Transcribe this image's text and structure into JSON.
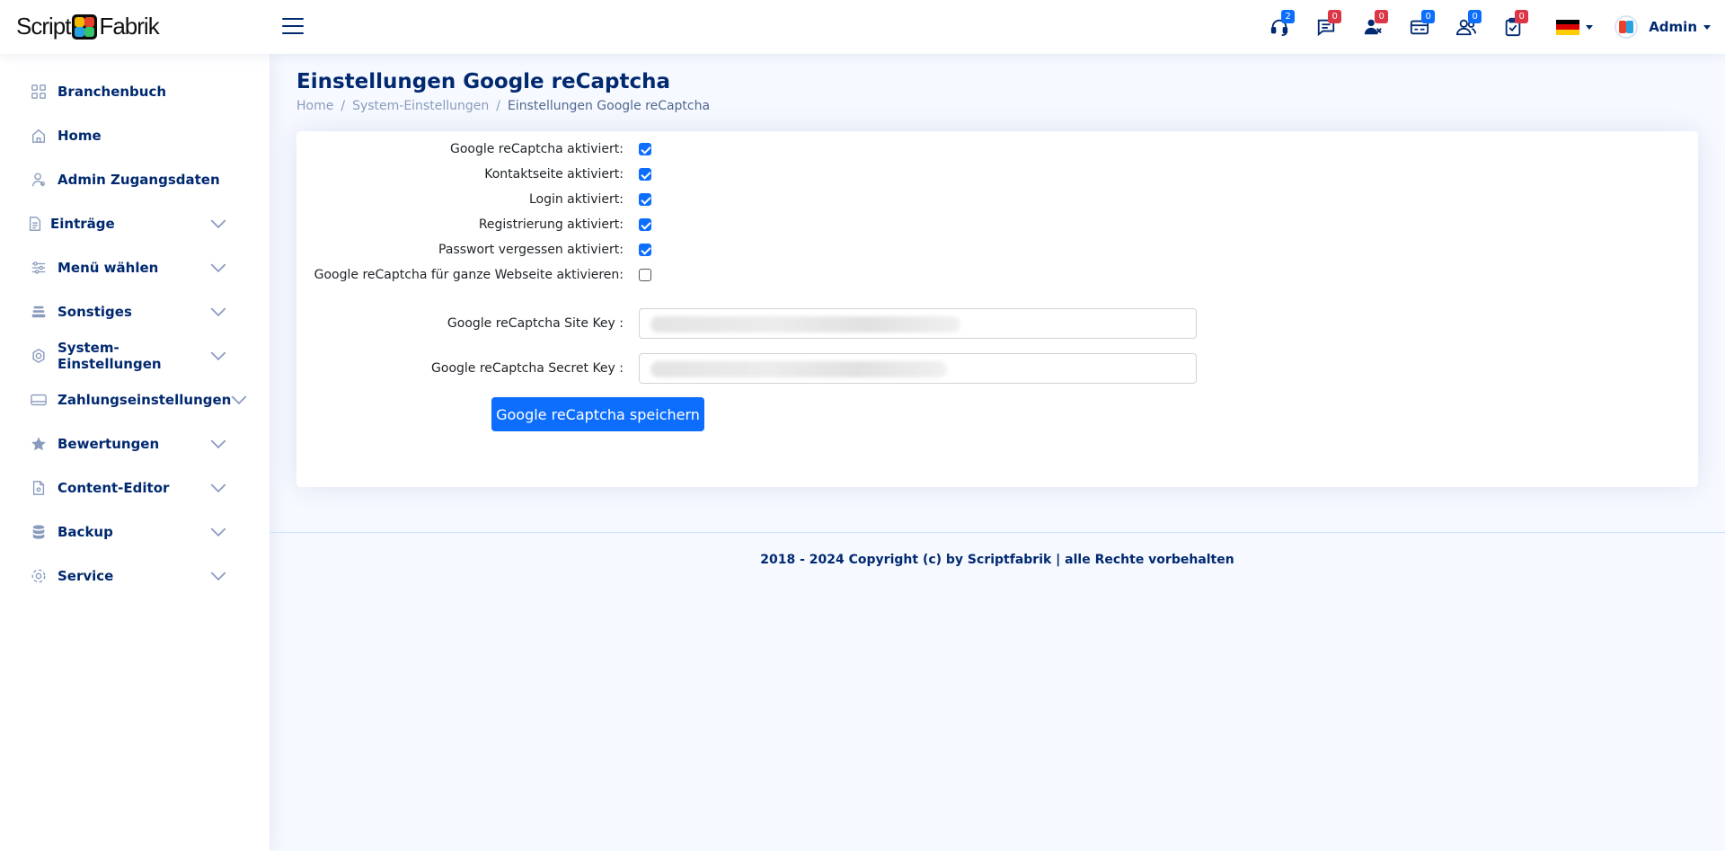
{
  "header": {
    "logo_left": "Script",
    "logo_right": "Fabrik",
    "notifications": [
      {
        "icon": "headset-icon",
        "count": "2",
        "color": "blue"
      },
      {
        "icon": "chat-icon",
        "count": "0",
        "color": "red"
      },
      {
        "icon": "user-x-icon",
        "count": "0",
        "color": "red"
      },
      {
        "icon": "card-icon",
        "count": "0",
        "color": "blue"
      },
      {
        "icon": "people-icon",
        "count": "0",
        "color": "blue"
      },
      {
        "icon": "clipboard-check-icon",
        "count": "0",
        "color": "red"
      }
    ],
    "profile_name": "Admin"
  },
  "sidebar": {
    "items": [
      {
        "label": "Branchenbuch",
        "icon": "grid-icon"
      },
      {
        "label": "Home",
        "icon": "house-icon"
      },
      {
        "label": "Admin Zugangsdaten",
        "icon": "person-icon"
      },
      {
        "label": "Einträge",
        "icon": "file-icon"
      },
      {
        "label": "Menü wählen",
        "icon": "sliders-icon"
      },
      {
        "label": "Sonstiges",
        "icon": "stack-icon"
      },
      {
        "label": "System-Einstellungen",
        "icon": "gear-icon"
      },
      {
        "label": "Zahlungseinstellungen",
        "icon": "credit-card-icon"
      },
      {
        "label": "Bewertungen",
        "icon": "star-icon"
      },
      {
        "label": "Content-Editor",
        "icon": "document-icon"
      },
      {
        "label": "Backup",
        "icon": "database-icon"
      },
      {
        "label": "Service",
        "icon": "service-icon"
      }
    ]
  },
  "page": {
    "title": "Einstellungen Google reCaptcha",
    "breadcrumb": [
      "Home",
      "System-Einstellungen",
      "Einstellungen Google reCaptcha"
    ],
    "separator": "/"
  },
  "form": {
    "checkboxes": [
      {
        "label": "Google reCaptcha aktiviert:",
        "checked": true
      },
      {
        "label": "Kontaktseite aktiviert:",
        "checked": true
      },
      {
        "label": "Login aktiviert:",
        "checked": true
      },
      {
        "label": "Registrierung aktiviert:",
        "checked": true
      },
      {
        "label": "Passwort vergessen aktiviert:",
        "checked": true
      },
      {
        "label": "Google reCaptcha für ganze Webseite aktivieren:",
        "checked": false
      }
    ],
    "site_key_label": "Google reCaptcha Site Key :",
    "secret_key_label": "Google reCaptcha Secret Key :",
    "save_label": "Google reCaptcha speichern"
  },
  "footer": {
    "text": "2018 - 2024 Copyright (c) by Scriptfabrik | alle Rechte vorbehalten"
  },
  "colors": {
    "primary": "#0d6efd",
    "navy": "#012970",
    "badge_red": "#dc3545",
    "background": "#f6f9ff"
  }
}
